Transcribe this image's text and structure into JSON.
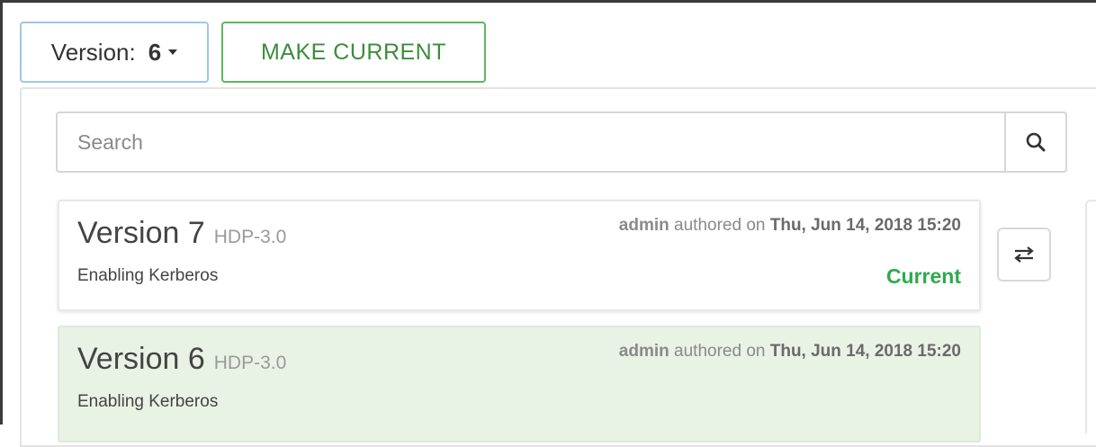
{
  "toolbar": {
    "version_label": "Version:",
    "version_value": "6",
    "make_current_label": "MAKE CURRENT"
  },
  "search": {
    "placeholder": "Search",
    "value": ""
  },
  "versions": [
    {
      "title": "Version 7",
      "stack": "HDP-3.0",
      "author": "admin",
      "authored_text": "authored on",
      "date": "Thu, Jun 14, 2018 15:20",
      "notes": "Enabling Kerberos",
      "status": "Current"
    },
    {
      "title": "Version 6",
      "stack": "HDP-3.0",
      "author": "admin",
      "authored_text": "authored on",
      "date": "Thu, Jun 14, 2018 15:20",
      "notes": "Enabling Kerberos",
      "status": ""
    }
  ],
  "icons": {
    "search": "search-icon",
    "compare": "compare-arrows-icon",
    "dropdown": "chevron-down-icon"
  },
  "colors": {
    "accent_green": "#5cb85c",
    "current_green": "#2eaa4e",
    "selected_row_bg": "#e9f3e5",
    "dropdown_border": "#9fc6e8"
  }
}
